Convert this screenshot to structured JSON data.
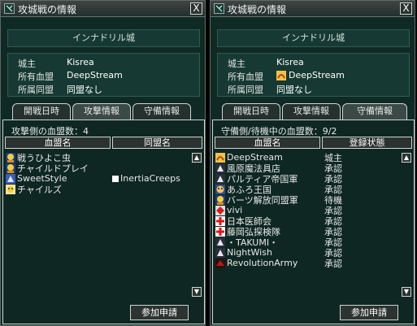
{
  "left": {
    "title": "攻城戦の情報",
    "close": "X",
    "castle": "インナドリル城",
    "info": {
      "lord_label": "城主",
      "lord_value": "Kisrea",
      "pledge_label": "所有血盟",
      "pledge_value": "DeepStream",
      "alliance_label": "所属同盟",
      "alliance_value": "同盟なし"
    },
    "tabs": [
      "開戦日時",
      "攻撃情報",
      "守備情報"
    ],
    "active_tab": "攻撃情報",
    "count_text": "攻撃側の血盟数：4",
    "col1": "血盟名",
    "col2": "同盟名",
    "rows": [
      {
        "name": "戦うひよこ虫",
        "alliance": "",
        "icon": "yellow-crest-icon"
      },
      {
        "name": "チャイルドプレイ",
        "alliance": "",
        "icon": "yellow-crest-icon"
      },
      {
        "name": "SweetStyle",
        "alliance": "InertiaCreeps",
        "icon": "blue-crest-icon"
      },
      {
        "name": "チャイルズ",
        "alliance": "",
        "icon": "yellow-crest-icon"
      }
    ],
    "button": "参加申請"
  },
  "right": {
    "title": "攻城戦の情報",
    "close": "X",
    "castle": "インナドリル城",
    "info": {
      "lord_label": "城主",
      "lord_value": "Kisrea",
      "pledge_label": "所有血盟",
      "pledge_value": "DeepStream",
      "alliance_label": "所属同盟",
      "alliance_value": "同盟なし"
    },
    "tabs": [
      "開戦日時",
      "攻撃情報",
      "守備情報"
    ],
    "active_tab": "守備情報",
    "count_text": "守備側/待機中の血盟数：9/2",
    "col1": "血盟名",
    "col2": "登録状態",
    "rows": [
      {
        "name": "DeepStream",
        "status": "城主",
        "icon": "orange-crest-icon"
      },
      {
        "name": "風原魔法具店",
        "status": "承認",
        "icon": "white-crest-icon"
      },
      {
        "name": "パルティア帝国軍",
        "status": "承認",
        "icon": "white-crest-icon"
      },
      {
        "name": "あふろ王国",
        "status": "承認",
        "icon": "face-crest-icon"
      },
      {
        "name": "バーツ解放同盟軍",
        "status": "待機",
        "icon": "yellow-crest-icon"
      },
      {
        "name": "vivi",
        "status": "承認",
        "icon": "red-crest-icon"
      },
      {
        "name": "日本医師会",
        "status": "承認",
        "icon": "redcross-crest-icon"
      },
      {
        "name": "藤岡弘探検隊",
        "status": "承認",
        "icon": "redcross-crest-icon"
      },
      {
        "name": "・TAKUMI・",
        "status": "承認",
        "icon": "white-crest-icon"
      },
      {
        "name": "NightWish",
        "status": "承認",
        "icon": "white-crest-icon"
      },
      {
        "name": "RevolutionArmy",
        "status": "承認",
        "icon": "dark-red-crest-icon"
      }
    ],
    "button": "参加申請"
  },
  "colors": {
    "window_bg": "#0f2a25",
    "panel_bg": "#163a33",
    "border": "#cfd3d2"
  }
}
